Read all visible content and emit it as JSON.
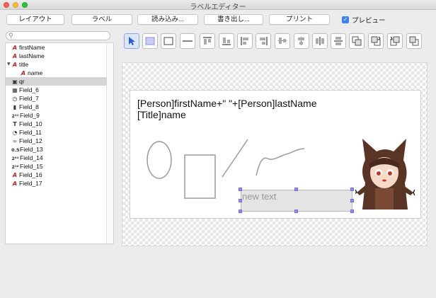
{
  "window": {
    "title": "ラベルエディター"
  },
  "toolbar": {
    "layout": "レイアウト",
    "label": "ラベル",
    "load": "読み込み...",
    "export": "書き出し...",
    "print": "プリント",
    "preview_label": "プレビュー",
    "preview_checked": true
  },
  "search": {
    "placeholder": "",
    "value": ""
  },
  "tree": [
    {
      "name": "firstName",
      "icon": "A",
      "icon_name": "text-field-icon"
    },
    {
      "name": "lastName",
      "icon": "A",
      "icon_name": "text-field-icon"
    },
    {
      "name": "title",
      "icon": "A",
      "icon_name": "text-field-icon",
      "expanded": true
    },
    {
      "name": "name",
      "icon": "A",
      "icon_name": "text-field-icon",
      "indent": true
    },
    {
      "name": "qr",
      "icon": "▣",
      "icon_name": "qr-code-icon",
      "selected": true
    },
    {
      "name": "Field_6",
      "icon": "▦",
      "icon_name": "calendar-icon"
    },
    {
      "name": "Field_7",
      "icon": "◷",
      "icon_name": "clock-icon"
    },
    {
      "name": "Field_8",
      "icon": "▮",
      "icon_name": "traffic-light-icon"
    },
    {
      "name": "Field_9",
      "icon": "2³²",
      "icon_name": "integer-32-icon"
    },
    {
      "name": "Field_10",
      "icon": "T",
      "icon_name": "text-icon"
    },
    {
      "name": "Field_11",
      "icon": "◔",
      "icon_name": "color-picture-icon"
    },
    {
      "name": "Field_12",
      "icon": "∞",
      "icon_name": "infinity-icon"
    },
    {
      "name": "Field_13",
      "icon": "0.5",
      "icon_name": "real-number-icon"
    },
    {
      "name": "Field_14",
      "icon": "2⁶⁴",
      "icon_name": "integer-64-icon"
    },
    {
      "name": "Field_15",
      "icon": "2¹⁶",
      "icon_name": "integer-16-icon"
    },
    {
      "name": "Field_16",
      "icon": "A",
      "icon_name": "text-field-icon"
    },
    {
      "name": "Field_17",
      "icon": "A",
      "icon_name": "text-field-icon"
    }
  ],
  "tools": [
    {
      "name": "select-arrow-tool",
      "active": true
    },
    {
      "name": "filled-rectangle-tool"
    },
    {
      "name": "rectangle-tool"
    },
    {
      "name": "line-tool"
    },
    {
      "name": "align-top-tool"
    },
    {
      "name": "align-bottom-tool"
    },
    {
      "name": "align-left-tool"
    },
    {
      "name": "align-right-tool"
    },
    {
      "name": "align-center-horizontal-tool"
    },
    {
      "name": "align-center-vertical-tool"
    },
    {
      "name": "distribute-horizontal-tool"
    },
    {
      "name": "distribute-vertical-tool"
    },
    {
      "name": "bring-to-front-tool"
    },
    {
      "name": "move-forward-tool"
    },
    {
      "name": "move-backward-tool"
    },
    {
      "name": "send-to-back-tool"
    }
  ],
  "label": {
    "line1": "[Person]firstName+\" \"+[Person]lastName",
    "line2": "[Title]name",
    "text_object": "new text"
  },
  "colors": {
    "accent": "#3b82f6",
    "selection": "#8c8cf0",
    "tree_selection": "#d5d5d5"
  }
}
